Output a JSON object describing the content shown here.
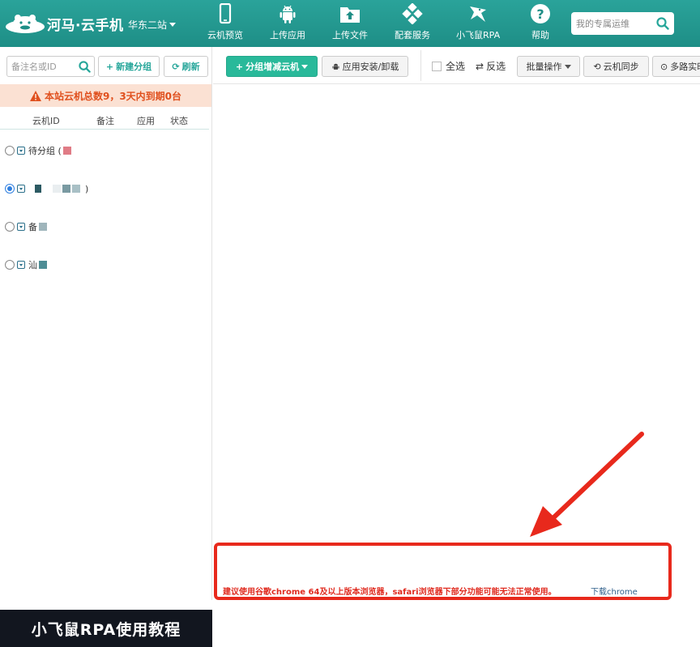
{
  "header": {
    "logo_text": "河马·云手机",
    "station": "华东二站",
    "nav": [
      {
        "label": "云机预览",
        "icon": "phone-icon"
      },
      {
        "label": "上传应用",
        "icon": "android-icon"
      },
      {
        "label": "上传文件",
        "icon": "upload-folder-icon"
      },
      {
        "label": "配套服务",
        "icon": "diamond-grid-icon"
      },
      {
        "label": "小飞鼠RPA",
        "icon": "flying-squirrel-icon"
      },
      {
        "label": "帮助",
        "icon": "help-icon"
      }
    ],
    "search_placeholder": "我的专属运维"
  },
  "left": {
    "search_placeholder": "备注名或ID",
    "new_group": "新建分组",
    "refresh": "刷新",
    "alert": "本站云机总数9，3天内到期0台",
    "columns": [
      "云机ID",
      "备注",
      "应用",
      "状态"
    ],
    "groups": [
      {
        "label": "待分组 (",
        "selected": false
      },
      {
        "label": ")",
        "selected": true
      },
      {
        "label": "备",
        "selected": false
      },
      {
        "label": "汕",
        "selected": false
      }
    ],
    "banner": "小飞鼠RPA使用教程"
  },
  "toolbar": {
    "group_add": "分组增减云机",
    "app_install": "应用安装/卸载",
    "select_all": "全选",
    "invert": "反选",
    "batch": "批量操作",
    "sync": "云机同步",
    "multi": "多路实时"
  },
  "notice": {
    "text": "建议使用谷歌chrome 64及以上版本浏览器，safari浏览器下部分功能可能无法正常使用。",
    "link": "下载chrome"
  },
  "colors": {
    "header": "#1e8e86",
    "accent": "#26a69a",
    "alert_bg": "#fbe1d3",
    "alert_text": "#e0501e",
    "notice_red": "#e02b1f",
    "annotation_red": "#e8291c"
  }
}
